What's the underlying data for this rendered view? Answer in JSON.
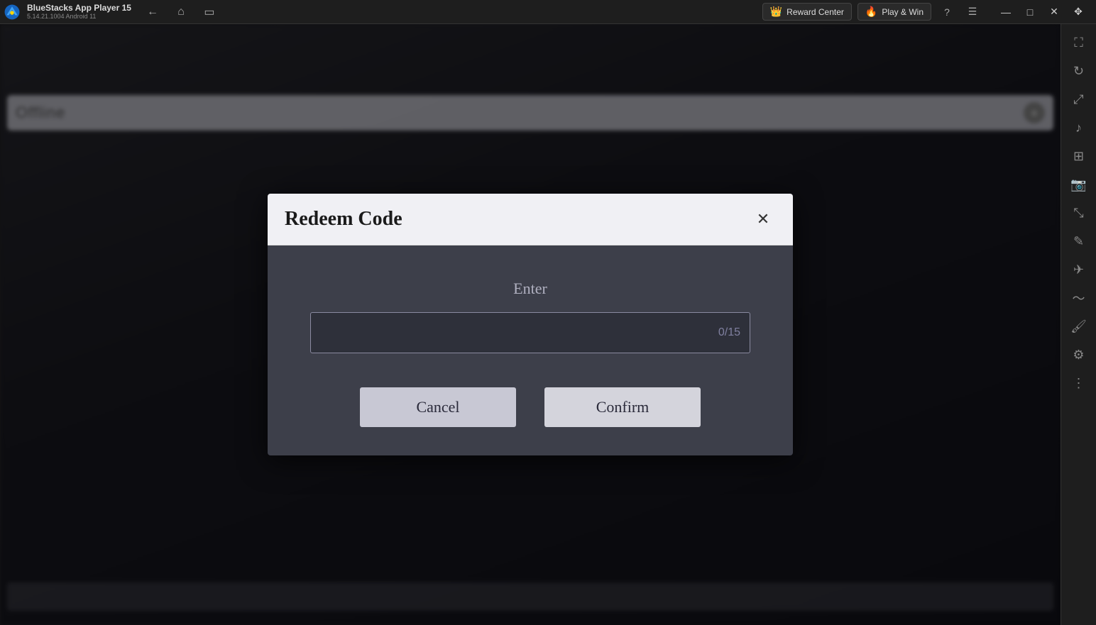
{
  "titlebar": {
    "app_name": "BlueStacks App Player 15",
    "app_version": "5.14.21.1004  Android 11",
    "reward_center_label": "Reward Center",
    "play_win_label": "Play & Win",
    "nav": {
      "back_label": "←",
      "home_label": "⌂",
      "copy_label": "⧉"
    },
    "window_controls": {
      "minimize": "—",
      "maximize": "□",
      "close": "✕",
      "restore": "❐"
    }
  },
  "sidebar": {
    "icons": [
      {
        "name": "expand-icon",
        "glyph": "⛶"
      },
      {
        "name": "rotate-icon",
        "glyph": "↻"
      },
      {
        "name": "fullscreen-icon",
        "glyph": "⤢"
      },
      {
        "name": "volume-icon",
        "glyph": "♪"
      },
      {
        "name": "apk-icon",
        "glyph": "⊞"
      },
      {
        "name": "screenshot-icon",
        "glyph": "📷"
      },
      {
        "name": "resize-icon",
        "glyph": "⤡"
      },
      {
        "name": "edit-icon",
        "glyph": "✎"
      },
      {
        "name": "plane-icon",
        "glyph": "✈"
      },
      {
        "name": "shake-icon",
        "glyph": "〜"
      },
      {
        "name": "paint-icon",
        "glyph": "🖌"
      },
      {
        "name": "settings-icon",
        "glyph": "⚙"
      },
      {
        "name": "more-icon",
        "glyph": "⋮"
      }
    ]
  },
  "dialog": {
    "title": "Redeem Code",
    "close_btn_label": "✕",
    "enter_label": "Enter",
    "input_placeholder": "",
    "input_counter": "0/15",
    "cancel_btn_label": "Cancel",
    "confirm_btn_label": "Confirm"
  },
  "ingame_topbar": {
    "text": "Offline"
  }
}
